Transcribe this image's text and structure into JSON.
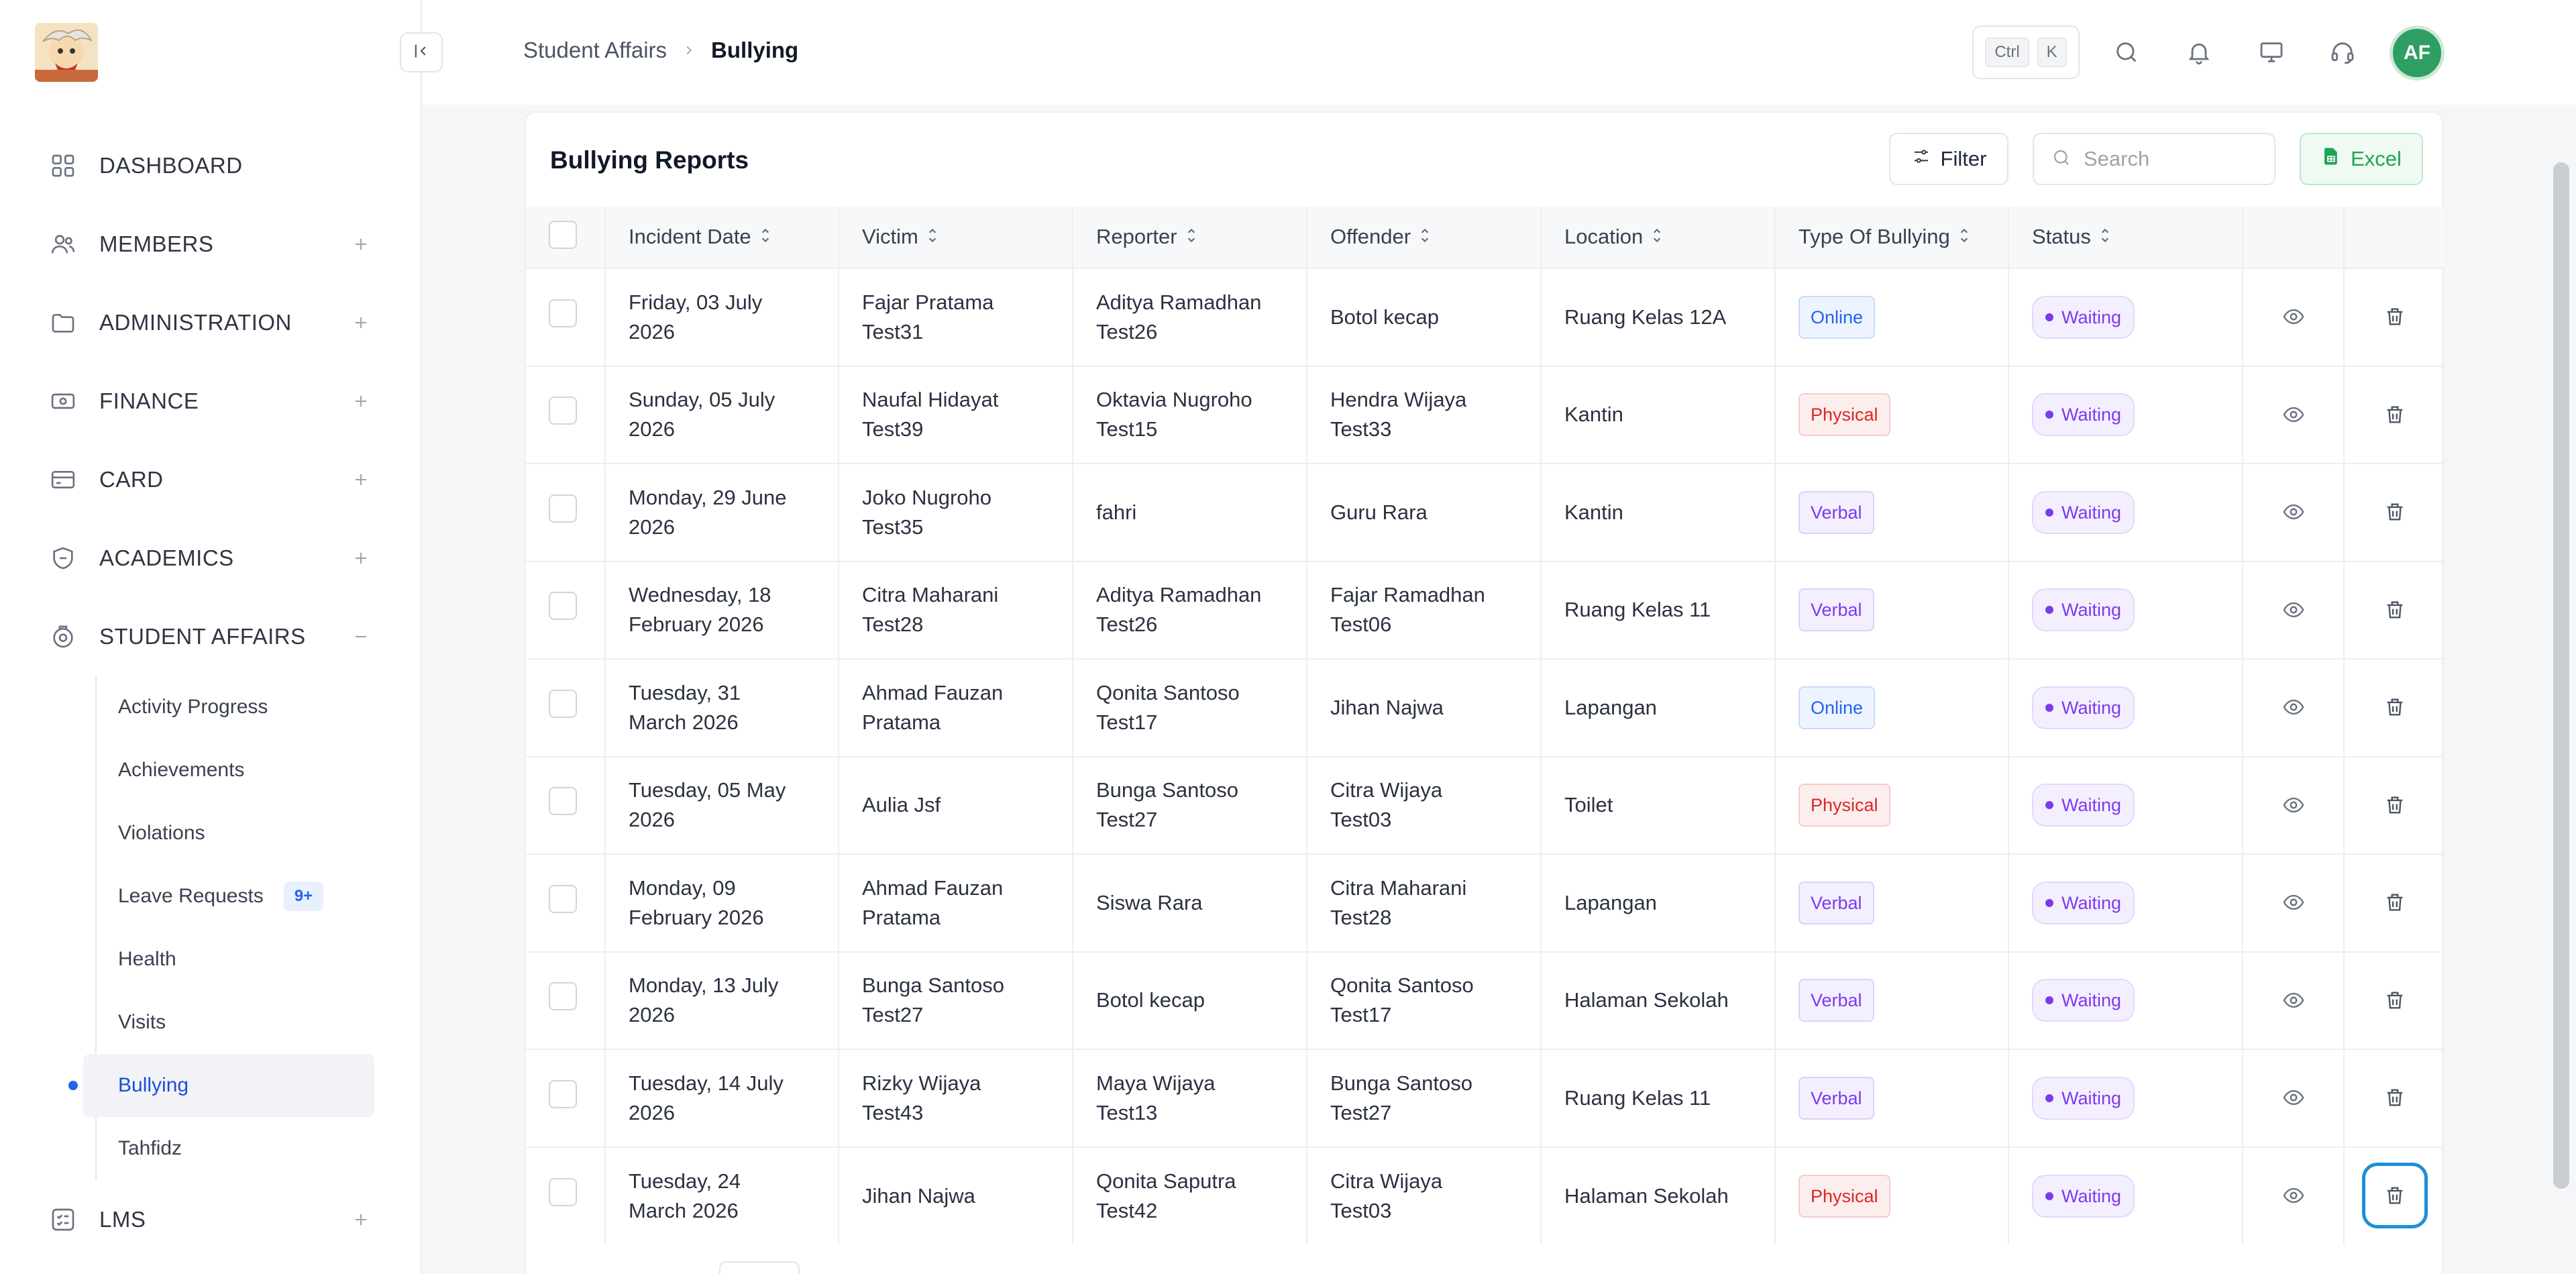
{
  "sidebar": {
    "collapse_label": "",
    "items": [
      {
        "label": "DASHBOARD",
        "icon": "grid-icon",
        "toggle": ""
      },
      {
        "label": "MEMBERS",
        "icon": "users-icon",
        "toggle": "+"
      },
      {
        "label": "ADMINISTRATION",
        "icon": "folder-icon",
        "toggle": "+"
      },
      {
        "label": "FINANCE",
        "icon": "banknote-icon",
        "toggle": "+"
      },
      {
        "label": "CARD",
        "icon": "credit-card-icon",
        "toggle": "+"
      },
      {
        "label": "ACADEMICS",
        "icon": "academic-icon",
        "toggle": "+"
      },
      {
        "label": "STUDENT AFFAIRS",
        "icon": "student-affairs-icon",
        "toggle": "−"
      }
    ],
    "submenu": [
      {
        "label": "Activity Progress"
      },
      {
        "label": "Achievements"
      },
      {
        "label": "Violations"
      },
      {
        "label": "Leave Requests",
        "badge": "9+"
      },
      {
        "label": "Health"
      },
      {
        "label": "Visits"
      },
      {
        "label": "Bullying",
        "active": true
      },
      {
        "label": "Tahfidz"
      }
    ],
    "lms": {
      "label": "LMS",
      "icon": "checklist-icon",
      "toggle": "+"
    }
  },
  "header": {
    "breadcrumb_parent": "Student Affairs",
    "breadcrumb_current": "Bullying",
    "shortcut_ctrl": "Ctrl",
    "shortcut_key": "K",
    "avatar_initials": "AF"
  },
  "card": {
    "title": "Bullying Reports",
    "filter_label": "Filter",
    "search_placeholder": "Search",
    "excel_label": "Excel"
  },
  "table": {
    "columns": [
      "Incident Date",
      "Victim",
      "Reporter",
      "Offender",
      "Location",
      "Type Of Bullying",
      "Status"
    ],
    "rows": [
      {
        "date": [
          "Friday, 03 July",
          "2026"
        ],
        "victim": [
          "Fajar Pratama",
          "Test31"
        ],
        "reporter": [
          "Aditya Ramadhan",
          "Test26"
        ],
        "offender": [
          "Botol kecap",
          ""
        ],
        "location": "Ruang Kelas 12A",
        "type": "Online",
        "status": "Waiting"
      },
      {
        "date": [
          "Sunday, 05 July",
          "2026"
        ],
        "victim": [
          "Naufal Hidayat",
          "Test39"
        ],
        "reporter": [
          "Oktavia Nugroho",
          "Test15"
        ],
        "offender": [
          "Hendra Wijaya",
          "Test33"
        ],
        "location": "Kantin",
        "type": "Physical",
        "status": "Waiting"
      },
      {
        "date": [
          "Monday, 29 June",
          "2026"
        ],
        "victim": [
          "Joko Nugroho",
          "Test35"
        ],
        "reporter": [
          "fahri",
          ""
        ],
        "offender": [
          "Guru Rara",
          ""
        ],
        "location": "Kantin",
        "type": "Verbal",
        "status": "Waiting"
      },
      {
        "date": [
          "Wednesday, 18",
          "February 2026"
        ],
        "victim": [
          "Citra Maharani",
          "Test28"
        ],
        "reporter": [
          "Aditya Ramadhan",
          "Test26"
        ],
        "offender": [
          "Fajar Ramadhan",
          "Test06"
        ],
        "location": "Ruang Kelas 11",
        "type": "Verbal",
        "status": "Waiting"
      },
      {
        "date": [
          "Tuesday, 31",
          "March 2026"
        ],
        "victim": [
          "Ahmad Fauzan",
          "Pratama"
        ],
        "reporter": [
          "Qonita Santoso",
          "Test17"
        ],
        "offender": [
          "Jihan Najwa",
          ""
        ],
        "location": "Lapangan",
        "type": "Online",
        "status": "Waiting"
      },
      {
        "date": [
          "Tuesday, 05 May",
          "2026"
        ],
        "victim": [
          "Aulia Jsf",
          ""
        ],
        "reporter": [
          "Bunga Santoso",
          "Test27"
        ],
        "offender": [
          "Citra Wijaya",
          "Test03"
        ],
        "location": "Toilet",
        "type": "Physical",
        "status": "Waiting"
      },
      {
        "date": [
          "Monday, 09",
          "February 2026"
        ],
        "victim": [
          "Ahmad Fauzan",
          "Pratama"
        ],
        "reporter": [
          "Siswa Rara",
          ""
        ],
        "offender": [
          "Citra Maharani",
          "Test28"
        ],
        "location": "Lapangan",
        "type": "Verbal",
        "status": "Waiting"
      },
      {
        "date": [
          "Monday, 13 July",
          "2026"
        ],
        "victim": [
          "Bunga Santoso",
          "Test27"
        ],
        "reporter": [
          "Botol kecap",
          ""
        ],
        "offender": [
          "Qonita Santoso",
          "Test17"
        ],
        "location": "Halaman Sekolah",
        "type": "Verbal",
        "status": "Waiting"
      },
      {
        "date": [
          "Tuesday, 14 July",
          "2026"
        ],
        "victim": [
          "Rizky Wijaya",
          "Test43"
        ],
        "reporter": [
          "Maya Wijaya",
          "Test13"
        ],
        "offender": [
          "Bunga Santoso",
          "Test27"
        ],
        "location": "Ruang Kelas 11",
        "type": "Verbal",
        "status": "Waiting"
      },
      {
        "date": [
          "Tuesday, 24",
          "March 2026"
        ],
        "victim": [
          "Jihan Najwa",
          ""
        ],
        "reporter": [
          "Qonita Saputra",
          "Test42"
        ],
        "offender": [
          "Citra Wijaya",
          "Test03"
        ],
        "location": "Halaman Sekolah",
        "type": "Physical",
        "status": "Waiting"
      }
    ]
  },
  "colors": {
    "accent": "#2563eb",
    "online": "#2563eb",
    "physical": "#dc2626",
    "verbal": "#7c3aed",
    "status_waiting": "#7c3aed",
    "excel": "#22a355",
    "avatar": "#2e9e62"
  }
}
